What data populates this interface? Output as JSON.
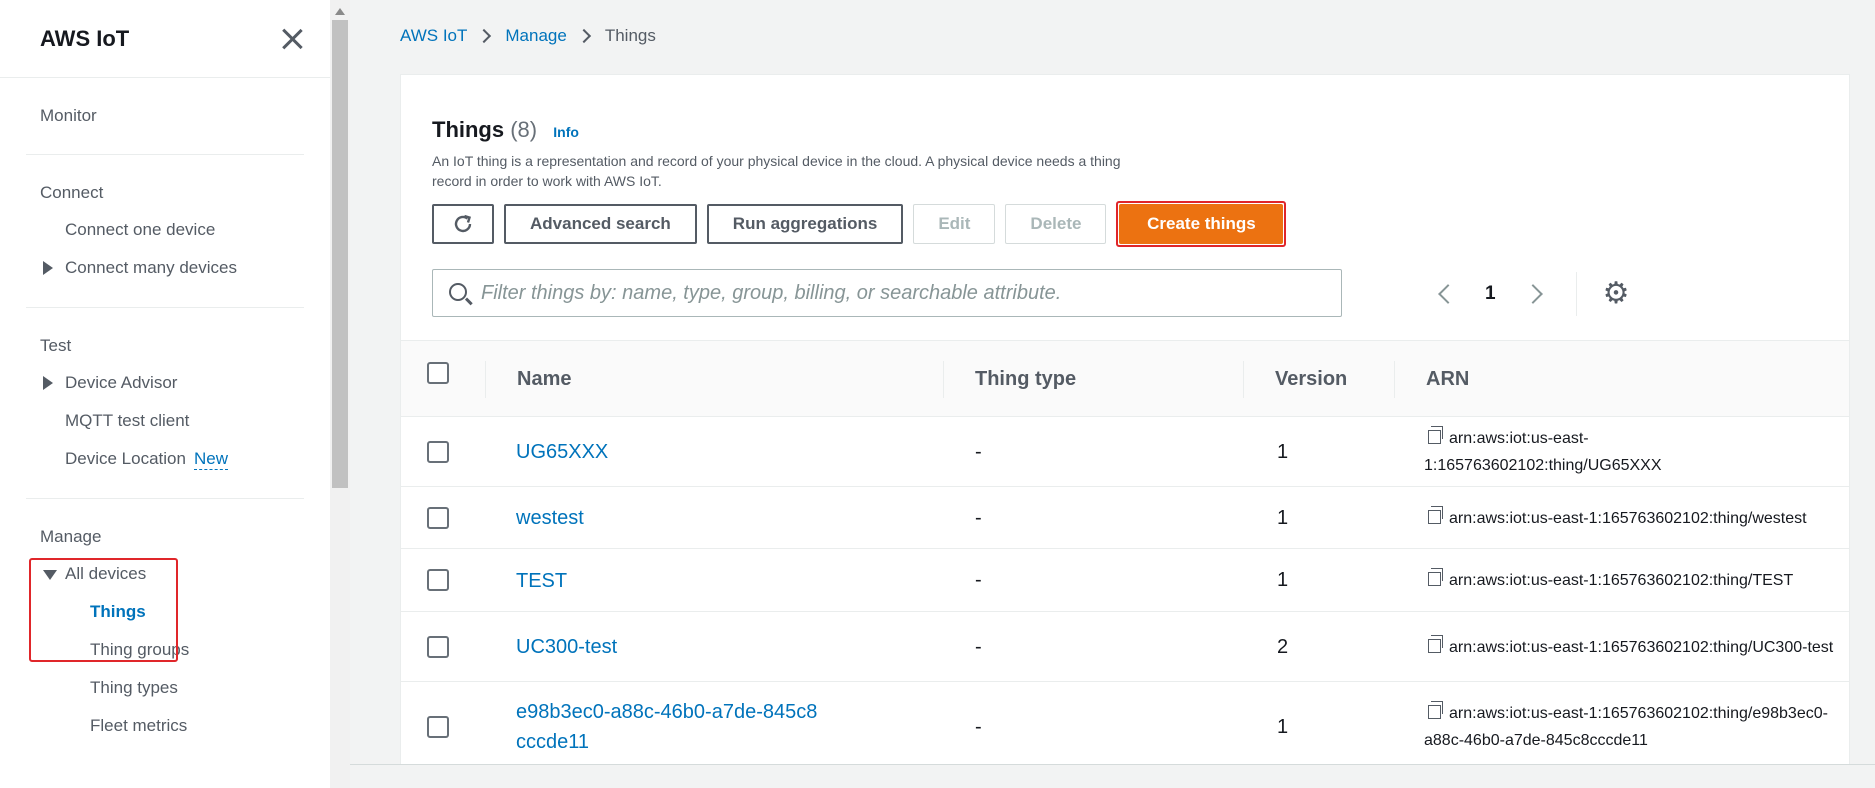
{
  "sidebar": {
    "title": "AWS IoT",
    "sections": {
      "monitor": "Monitor",
      "connect": {
        "heading": "Connect",
        "items": [
          "Connect one device",
          "Connect many devices"
        ]
      },
      "test": {
        "heading": "Test",
        "items": [
          "Device Advisor",
          "MQTT test client",
          "Device Location"
        ],
        "new_badge": "New"
      },
      "manage": {
        "heading": "Manage",
        "all_devices": "All devices",
        "items": [
          "Things",
          "Thing groups",
          "Thing types",
          "Fleet metrics"
        ]
      }
    }
  },
  "breadcrumb": [
    "AWS IoT",
    "Manage",
    "Things"
  ],
  "panel": {
    "title": "Things",
    "count": "(8)",
    "info": "Info",
    "description": "An IoT thing is a representation and record of your physical device in the cloud. A physical device needs a thing record in order to work with AWS IoT."
  },
  "actions": {
    "advanced_search": "Advanced search",
    "run_aggregations": "Run aggregations",
    "edit": "Edit",
    "delete": "Delete",
    "create_things": "Create things"
  },
  "search": {
    "placeholder": "Filter things by: name, type, group, billing, or searchable attribute."
  },
  "pagination": {
    "current_page": "1"
  },
  "table": {
    "columns": [
      "Name",
      "Thing type",
      "Version",
      "ARN"
    ],
    "rows": [
      {
        "name": "UG65XXX",
        "type": "-",
        "version": "1",
        "arn": "arn:aws:iot:us-east-1:165763602102:thing/UG65XXX"
      },
      {
        "name": "westest",
        "type": "-",
        "version": "1",
        "arn": "arn:aws:iot:us-east-1:165763602102:thing/westest"
      },
      {
        "name": "TEST",
        "type": "-",
        "version": "1",
        "arn": "arn:aws:iot:us-east-1:165763602102:thing/TEST"
      },
      {
        "name": "UC300-test",
        "type": "-",
        "version": "2",
        "arn": "arn:aws:iot:us-east-1:165763602102:thing/UC300-test"
      },
      {
        "name": "e98b3ec0-a88c-46b0-a7de-845c8cccde11",
        "type": "-",
        "version": "1",
        "arn": "arn:aws:iot:us-east-1:165763602102:thing/e98b3ec0-a88c-46b0-a7de-845c8cccde11"
      }
    ]
  },
  "colors": {
    "accent": "#0073bb",
    "primary_button": "#ec7211",
    "highlight": "#e0262a"
  }
}
